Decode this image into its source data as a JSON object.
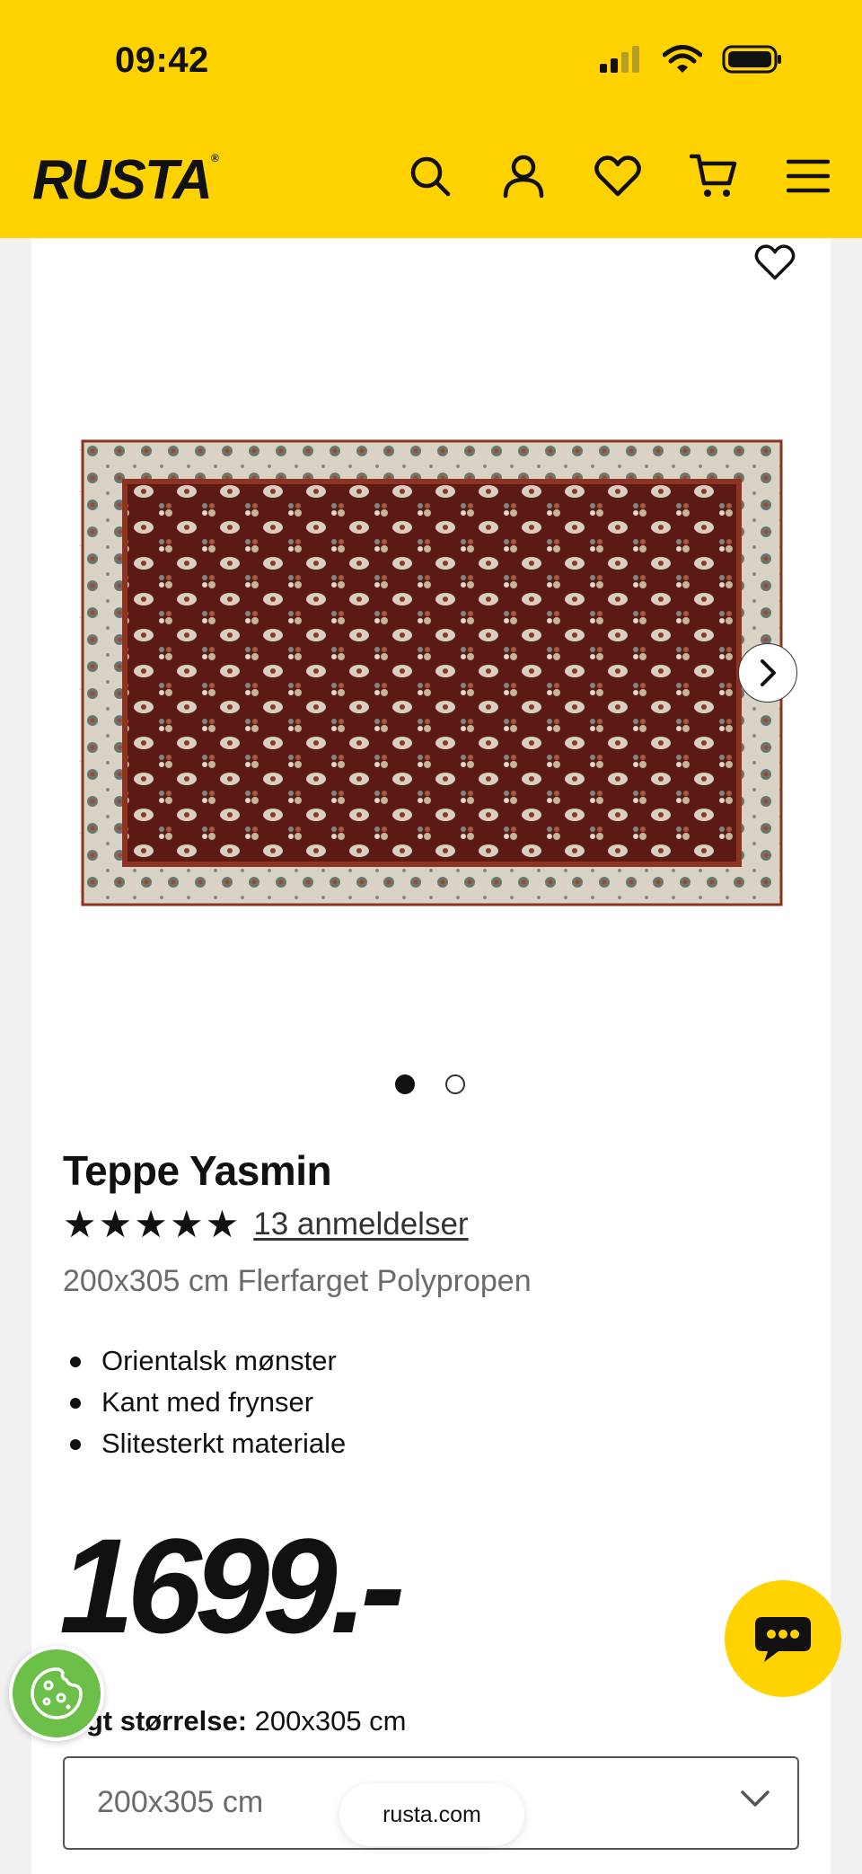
{
  "status_bar": {
    "time": "09:42"
  },
  "header": {
    "logo_text": "RUSTA",
    "logo_mark": "®",
    "icons": [
      "search-icon",
      "account-icon",
      "heart-icon",
      "cart-icon",
      "menu-icon"
    ]
  },
  "gallery": {
    "image_index": 1,
    "image_count": 2
  },
  "product": {
    "title": "Teppe Yasmin",
    "stars": "★★★★★",
    "rating": 5,
    "reviews_link": "13 anmeldelser",
    "subtitle": "200x305 cm Flerfarget Polypropen",
    "features": [
      "Orientalsk mønster",
      "Kant med frynser",
      "Slitesterkt materiale"
    ],
    "price": "1699.-"
  },
  "size": {
    "label_bold": "algt størrelse:",
    "label_value": " 200x305 cm",
    "selected": "200x305 cm"
  },
  "browser": {
    "url": "rusta.com"
  },
  "colors": {
    "brand_yellow": "#ffd200",
    "cookie_green": "#6cc04a",
    "rug_red": "#5c1a14",
    "rug_border": "#d9d3c6"
  }
}
